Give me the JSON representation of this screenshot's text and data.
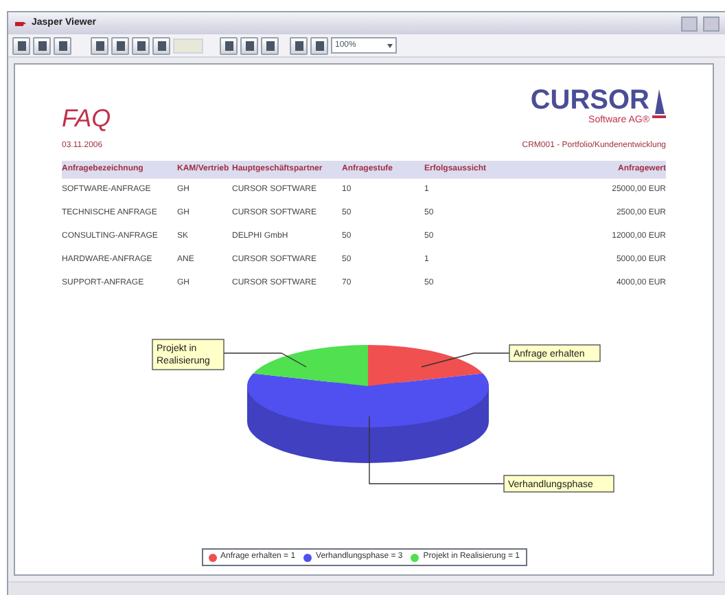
{
  "window": {
    "title": "Jasper Viewer"
  },
  "toolbar": {
    "zoom": "100%"
  },
  "report": {
    "title": "FAQ",
    "logo": {
      "name": "CURSOR",
      "subtitle": "Software AG®"
    },
    "date": "03.11.2006",
    "subtitle": "CRM001 - Portfolio/Kundenentwicklung",
    "table": {
      "columns": [
        "Anfragebezeichnung",
        "KAM/Vertrieb",
        "Hauptgeschäftspartner",
        "Anfragestufe",
        "Erfolgsaussicht",
        "Anfragewert"
      ],
      "rows": [
        [
          "SOFTWARE-ANFRAGE",
          "GH",
          "CURSOR SOFTWARE",
          "10",
          "1",
          "25000,00 EUR"
        ],
        [
          "TECHNISCHE ANFRAGE",
          "GH",
          "CURSOR SOFTWARE",
          "50",
          "50",
          "2500,00 EUR"
        ],
        [
          "CONSULTING-ANFRAGE",
          "SK",
          "DELPHI GmbH",
          "50",
          "50",
          "12000,00 EUR"
        ],
        [
          "HARDWARE-ANFRAGE",
          "ANE",
          "CURSOR SOFTWARE",
          "50",
          "1",
          "5000,00 EUR"
        ],
        [
          "SUPPORT-ANFRAGE",
          "GH",
          "CURSOR SOFTWARE",
          "70",
          "50",
          "4000,00 EUR"
        ]
      ]
    },
    "chart": {
      "chart_data": {
        "type": "pie",
        "categories": [
          "Anfrage erhalten",
          "Verhandlungsphase",
          "Projekt in Realisierung"
        ],
        "values": [
          20,
          60,
          20
        ]
      },
      "legend": [
        {
          "label": "Anfrage erhalten = 1",
          "color": "#f05050"
        },
        {
          "label": "Verhandlungsphase = 3",
          "color": "#5050f0"
        },
        {
          "label": "Projekt in Realisierung = 1",
          "color": "#50e050"
        }
      ]
    }
  }
}
